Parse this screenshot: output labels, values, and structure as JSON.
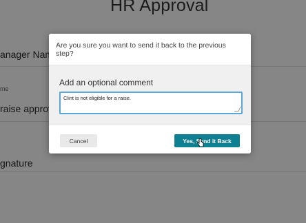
{
  "page": {
    "title": "HR Approval",
    "fields": [
      {
        "label": "anager Name"
      },
      {
        "small": "me"
      },
      {
        "label": "raise approve"
      },
      {
        "label": "gnature"
      }
    ]
  },
  "modal": {
    "question": "Are you sure you want to send it back to the previous step?",
    "comment_label": "Add an optional comment",
    "comment_value": "Clint is not eligible for a raise.",
    "cancel_label": "Cancel",
    "confirm_label": "Yes, Send it Back"
  },
  "icons": {
    "cursor": "hand-pointer-icon",
    "resize": "resize-handle-icon"
  },
  "colors": {
    "accent": "#0f7f92",
    "focus_border": "#5aa7d8"
  }
}
